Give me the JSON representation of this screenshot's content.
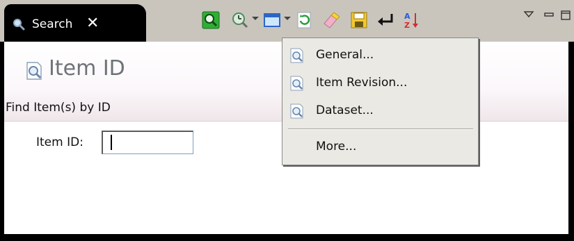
{
  "tab": {
    "label": "Search"
  },
  "header": {
    "title": "Item ID",
    "subtitle": "Find Item(s) by ID"
  },
  "form": {
    "item_id_label": "Item ID:",
    "item_id_value": ""
  },
  "menu": {
    "items": [
      {
        "label": "General..."
      },
      {
        "label": "Item Revision..."
      },
      {
        "label": "Dataset..."
      }
    ],
    "more_label": "More..."
  },
  "toolbar": {
    "icons": [
      "search-icon",
      "history-search-icon",
      "view-icon",
      "refresh-icon",
      "clear-icon",
      "save-icon",
      "return-icon",
      "sort-icon",
      "view-menu-icon",
      "minimize-icon",
      "maximize-icon"
    ]
  }
}
